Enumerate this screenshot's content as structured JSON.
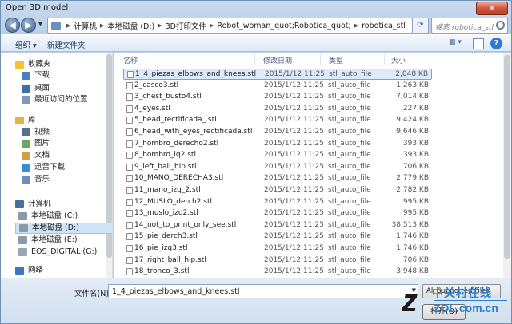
{
  "window": {
    "title": "Open 3D model",
    "close_label": "✕"
  },
  "address": {
    "crumbs": [
      "计算机",
      "本地磁盘 (D:)",
      "3D打印文件",
      "Robot_woman_quot;Robotica_quot;",
      "robotica_stl"
    ],
    "search_placeholder": "搜索 robotica_stl"
  },
  "toolbar": {
    "organize": "组织 ▾",
    "new_folder": "新建文件夹",
    "help": "?"
  },
  "nav": [
    {
      "label": "收藏夹",
      "icon": "star-icon",
      "color": "#f2c331"
    },
    {
      "label": "下载",
      "icon": "download-folder-icon",
      "color": "#4a7fc1"
    },
    {
      "label": "桌面",
      "icon": "desktop-icon",
      "color": "#3b6fb0"
    },
    {
      "label": "最近访问的位置",
      "icon": "recent-icon",
      "color": "#7f98b8"
    },
    {
      "label": "库",
      "icon": "library-icon",
      "color": "#e3b34a"
    },
    {
      "label": "视频",
      "icon": "video-icon",
      "color": "#5a6f8c"
    },
    {
      "label": "图片",
      "icon": "picture-icon",
      "color": "#6aa56a"
    },
    {
      "label": "文档",
      "icon": "document-icon",
      "color": "#c9a24a"
    },
    {
      "label": "迅雷下载",
      "icon": "thunder-icon",
      "color": "#3a8ad8"
    },
    {
      "label": "音乐",
      "icon": "music-icon",
      "color": "#6c8fbd"
    },
    {
      "label": "计算机",
      "icon": "computer-icon",
      "color": "#4a6f9c"
    },
    {
      "label": "本地磁盘 (C:)",
      "icon": "disk-icon",
      "color": "#8b9aab"
    },
    {
      "label": "本地磁盘 (D:)",
      "icon": "disk-icon",
      "color": "#8b9aab"
    },
    {
      "label": "本地磁盘 (E:)",
      "icon": "disk-icon",
      "color": "#8b9aab"
    },
    {
      "label": "EOS_DIGITAL (G:)",
      "icon": "removable-disk-icon",
      "color": "#9aa6b3"
    },
    {
      "label": "网络",
      "icon": "network-icon",
      "color": "#3e76c0"
    }
  ],
  "columns": {
    "name": "名称",
    "date": "修改日期",
    "type": "类型",
    "size": "大小"
  },
  "files": [
    {
      "name": "1_4_piezas_elbows_and_knees.stl",
      "date": "2015/1/12 11:25",
      "type": "stl_auto_file",
      "size": "2,048 KB"
    },
    {
      "name": "2_casco3.stl",
      "date": "2015/1/12 11:25",
      "type": "stl_auto_file",
      "size": "1,263 KB"
    },
    {
      "name": "3_chest_busto4.stl",
      "date": "2015/1/12 11:25",
      "type": "stl_auto_file",
      "size": "7,014 KB"
    },
    {
      "name": "4_eyes.stl",
      "date": "2015/1/12 11:25",
      "type": "stl_auto_file",
      "size": "227 KB"
    },
    {
      "name": "5_head_rectificada_.stl",
      "date": "2015/1/12 11:25",
      "type": "stl_auto_file",
      "size": "9,424 KB"
    },
    {
      "name": "6_head_with_eyes_rectificada.stl",
      "date": "2015/1/12 11:25",
      "type": "stl_auto_file",
      "size": "9,646 KB"
    },
    {
      "name": "7_hombro_derecho2.stl",
      "date": "2015/1/12 11:25",
      "type": "stl_auto_file",
      "size": "393 KB"
    },
    {
      "name": "8_hombro_iq2.stl",
      "date": "2015/1/12 11:25",
      "type": "stl_auto_file",
      "size": "393 KB"
    },
    {
      "name": "9_left_ball_hip.stl",
      "date": "2015/1/12 11:25",
      "type": "stl_auto_file",
      "size": "706 KB"
    },
    {
      "name": "10_MANO_DERECHA3.stl",
      "date": "2015/1/12 11:25",
      "type": "stl_auto_file",
      "size": "2,779 KB"
    },
    {
      "name": "11_mano_izq_2.stl",
      "date": "2015/1/12 11:25",
      "type": "stl_auto_file",
      "size": "2,782 KB"
    },
    {
      "name": "12_MUSLO_derch2.stl",
      "date": "2015/1/12 11:25",
      "type": "stl_auto_file",
      "size": "995 KB"
    },
    {
      "name": "13_muslo_izq2.stl",
      "date": "2015/1/12 11:25",
      "type": "stl_auto_file",
      "size": "995 KB"
    },
    {
      "name": "14_not_to_print_only_see.stl",
      "date": "2015/1/12 11:25",
      "type": "stl_auto_file",
      "size": "38,513 KB"
    },
    {
      "name": "15_pie_derch3.stl",
      "date": "2015/1/12 11:25",
      "type": "stl_auto_file",
      "size": "1,746 KB"
    },
    {
      "name": "16_pie_izq3.stl",
      "date": "2015/1/12 11:25",
      "type": "stl_auto_file",
      "size": "1,746 KB"
    },
    {
      "name": "17_right_ball_hip.stl",
      "date": "2015/1/12 11:25",
      "type": "stl_auto_file",
      "size": "706 KB"
    },
    {
      "name": "18_tronco_3.stl",
      "date": "2015/1/12 11:25",
      "type": "stl_auto_file",
      "size": "3,948 KB"
    }
  ],
  "bottom": {
    "filename_label": "文件名(N):",
    "filename_value": "1_4_piezas_elbows_and_knees.stl",
    "filter_value": "All Supported Files",
    "open_label": "打开(O)"
  },
  "watermark": {
    "letter": "z",
    "cn": "中关村在线",
    "en": "ZOL.com.cn"
  }
}
